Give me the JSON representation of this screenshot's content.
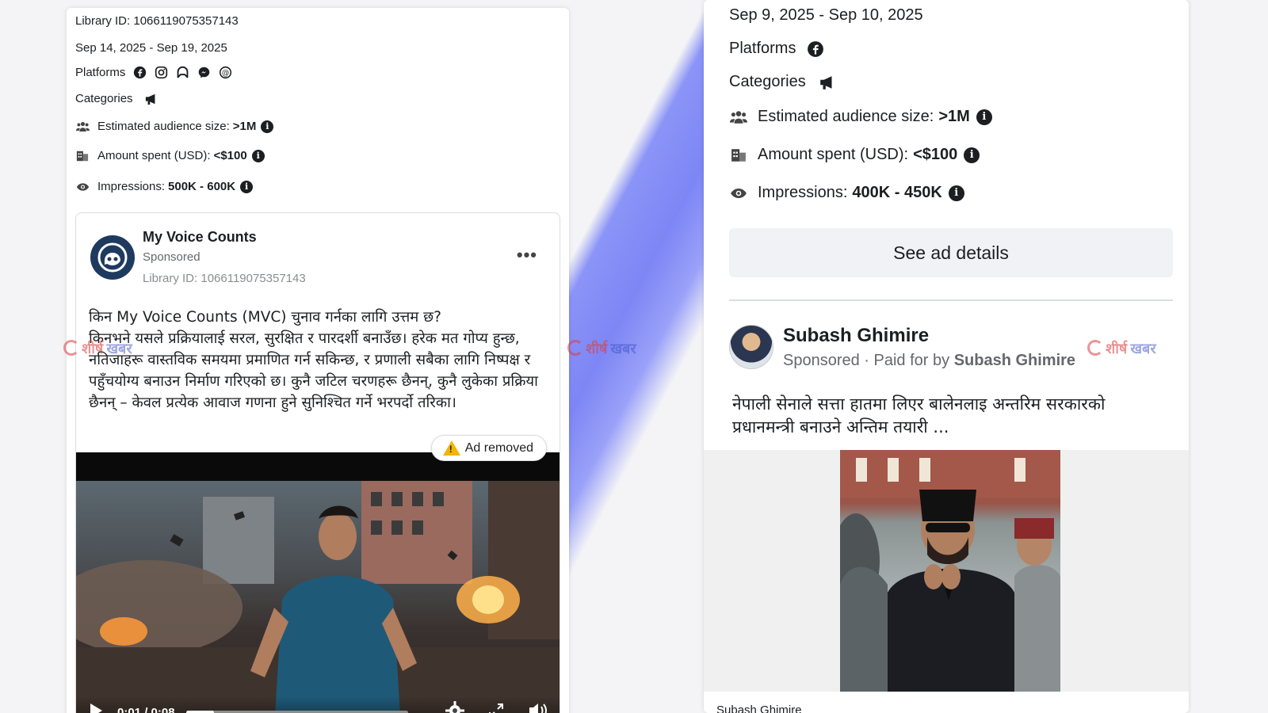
{
  "left_card": {
    "library_id": "Library ID: 1066119075357143",
    "date_range": "Sep 14, 2025 - Sep 19, 2025",
    "platforms_label": "Platforms",
    "categories_label": "Categories",
    "audience_label": "Estimated audience size:",
    "audience_value": ">1M",
    "spent_label": "Amount spent (USD):",
    "spent_value": "<$100",
    "impressions_label": "Impressions:",
    "impressions_value": "500K - 600K",
    "ad": {
      "page_name": "My Voice Counts",
      "sponsored": "Sponsored",
      "library_id": "Library ID: 1066119075357143",
      "more": "•••",
      "body": "किन My Voice Counts (MVC) चुनाव गर्नका लागि उत्तम छ?\nकिनभने यसले प्रक्रियालाई सरल, सुरक्षित र पारदर्शी बनाउँछ। हरेक मत गोप्य हुन्छ, नतिजाहरू वास्तविक समयमा प्रमाणित गर्न सकिन्छ, र प्रणाली सबैका लागि निष्पक्ष र पहुँचयोग्य बनाउन निर्माण गरिएको छ। कुनै जटिल चरणहरू छैनन्, कुनै लुकेका प्रक्रिया छैनन् – केवल प्रत्येक आवाज गणना हुने सुनिश्चित गर्ने भरपर्दो तरिका।",
      "ad_removed": "Ad removed",
      "video_time": "0:01 / 0:08",
      "video_progress": 0.125
    }
  },
  "right_card": {
    "date_range": "Sep 9, 2025 - Sep 10, 2025",
    "platforms_label": "Platforms",
    "categories_label": "Categories",
    "audience_label": "Estimated audience size:",
    "audience_value": ">1M",
    "spent_label": "Amount spent (USD):",
    "spent_value": "<$100",
    "impressions_label": "Impressions:",
    "impressions_value": "400K - 450K",
    "see_details": "See ad details",
    "ad": {
      "page_name": "Subash Ghimire",
      "sponsored": "Sponsored",
      "paid_for_by_label": " · Paid for by ",
      "paid_for_by": "Subash Ghimire",
      "body": "नेपाली सेनाले सत्ता हातमा लिएर बालेनलाइ अन्तरिम सरकारको प्रधानमन्त्री बनाउने अन्तिम तयारी ...",
      "footer_name": "Subash Ghimire"
    }
  },
  "watermark": {
    "word1": "शीर्ष",
    "word2": "खबर"
  },
  "colors": {
    "stripe": "#7d86f5",
    "facebook_blue": "#1877f2",
    "mvc_avatar": "#1f3a5f",
    "warning": "#f5b400"
  },
  "icons": {
    "platforms_left": [
      "facebook-icon",
      "instagram-icon",
      "audience-network-icon",
      "messenger-icon",
      "threads-icon"
    ],
    "platforms_right": [
      "facebook-icon"
    ],
    "categories": "megaphone-icon",
    "audience": "people-icon",
    "spent": "money-icon",
    "impressions": "eye-icon",
    "info": "info-icon"
  }
}
